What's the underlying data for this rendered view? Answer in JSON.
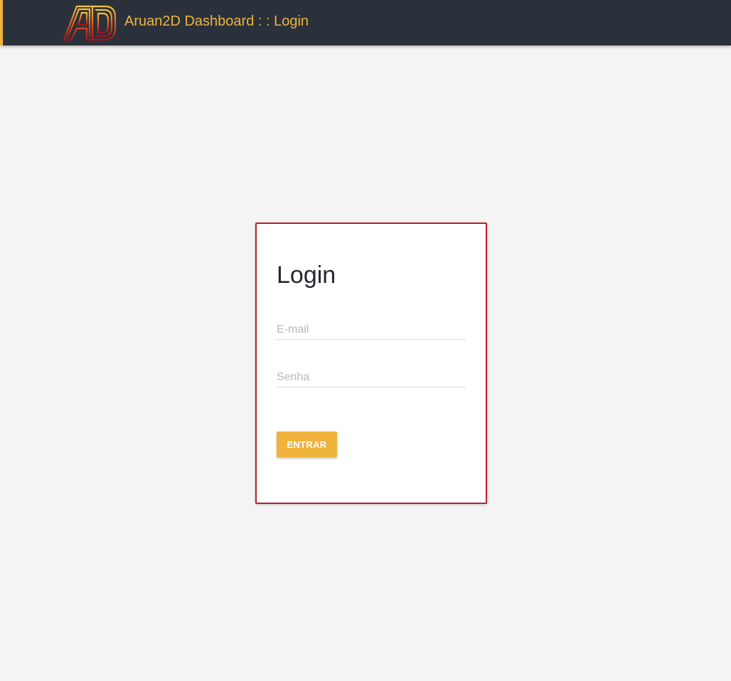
{
  "header": {
    "logo_icon": "ad-monogram-logo-icon",
    "title": "Aruan2D Dashboard : : Login"
  },
  "login": {
    "heading": "Login",
    "email_placeholder": "E-mail",
    "password_placeholder": "Senha",
    "submit_label": "ENTRAR"
  },
  "colors": {
    "topbar": "#2a313b",
    "accent": "#f0b43c",
    "card_border": "#b3232b",
    "background": "#f4f4f4"
  }
}
